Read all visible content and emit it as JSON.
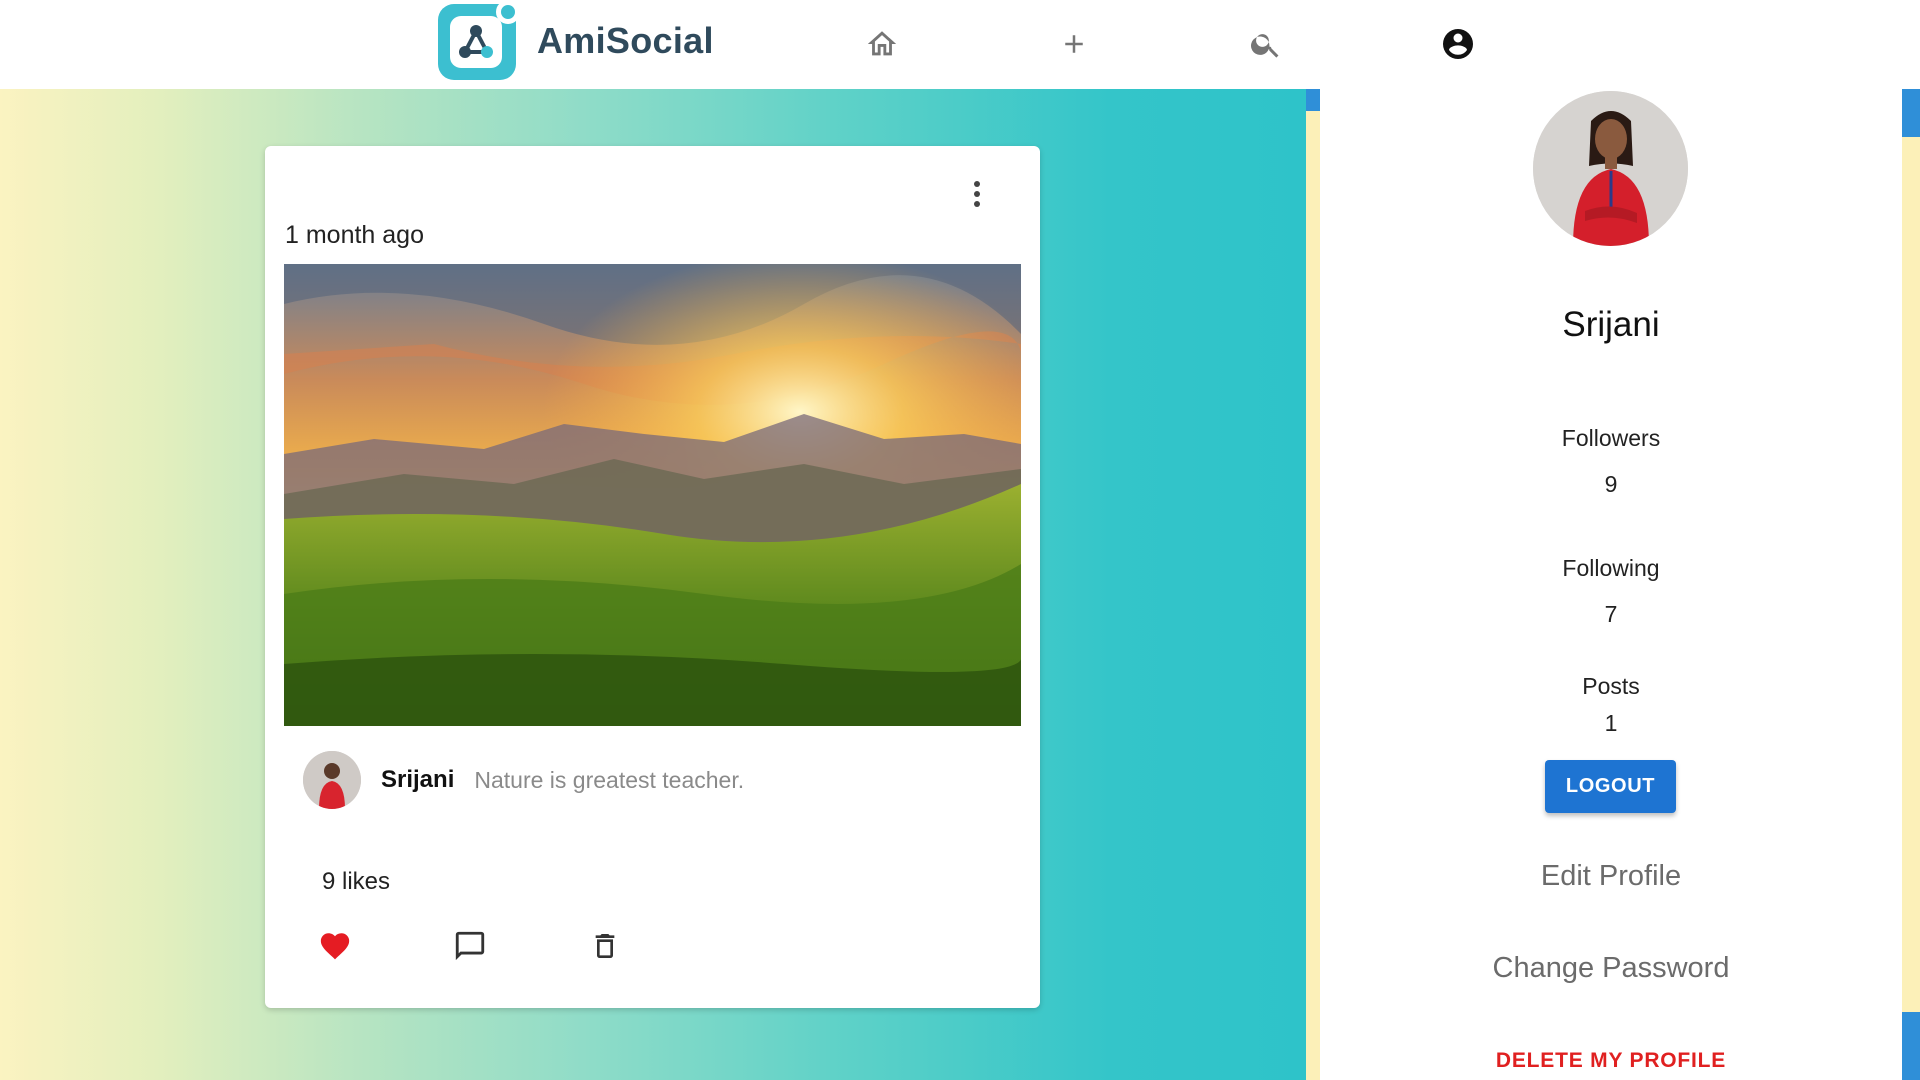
{
  "app": {
    "name": "AmiSocial",
    "brand_color": "#3cbfd0"
  },
  "nav": {
    "icons": [
      "home-icon",
      "add-icon",
      "search-icon",
      "account-circle-icon"
    ]
  },
  "post": {
    "time": "1 month ago",
    "image_alt": "Sunset over green hills",
    "author": "Srijani",
    "caption": "Nature is greatest teacher.",
    "likes": "9 likes",
    "liked": true,
    "like_color": "#e51c23"
  },
  "profile": {
    "name": "Srijani",
    "stats": [
      {
        "label": "Followers",
        "value": "9"
      },
      {
        "label": "Following",
        "value": "7"
      },
      {
        "label": "Posts",
        "value": "1"
      }
    ],
    "logout_label": "LOGOUT",
    "edit_profile_label": "Edit Profile",
    "change_password_label": "Change Password",
    "delete_label": "DELETE MY PROFILE",
    "accent_color": "#1e74d2",
    "danger_color": "#e02020"
  }
}
